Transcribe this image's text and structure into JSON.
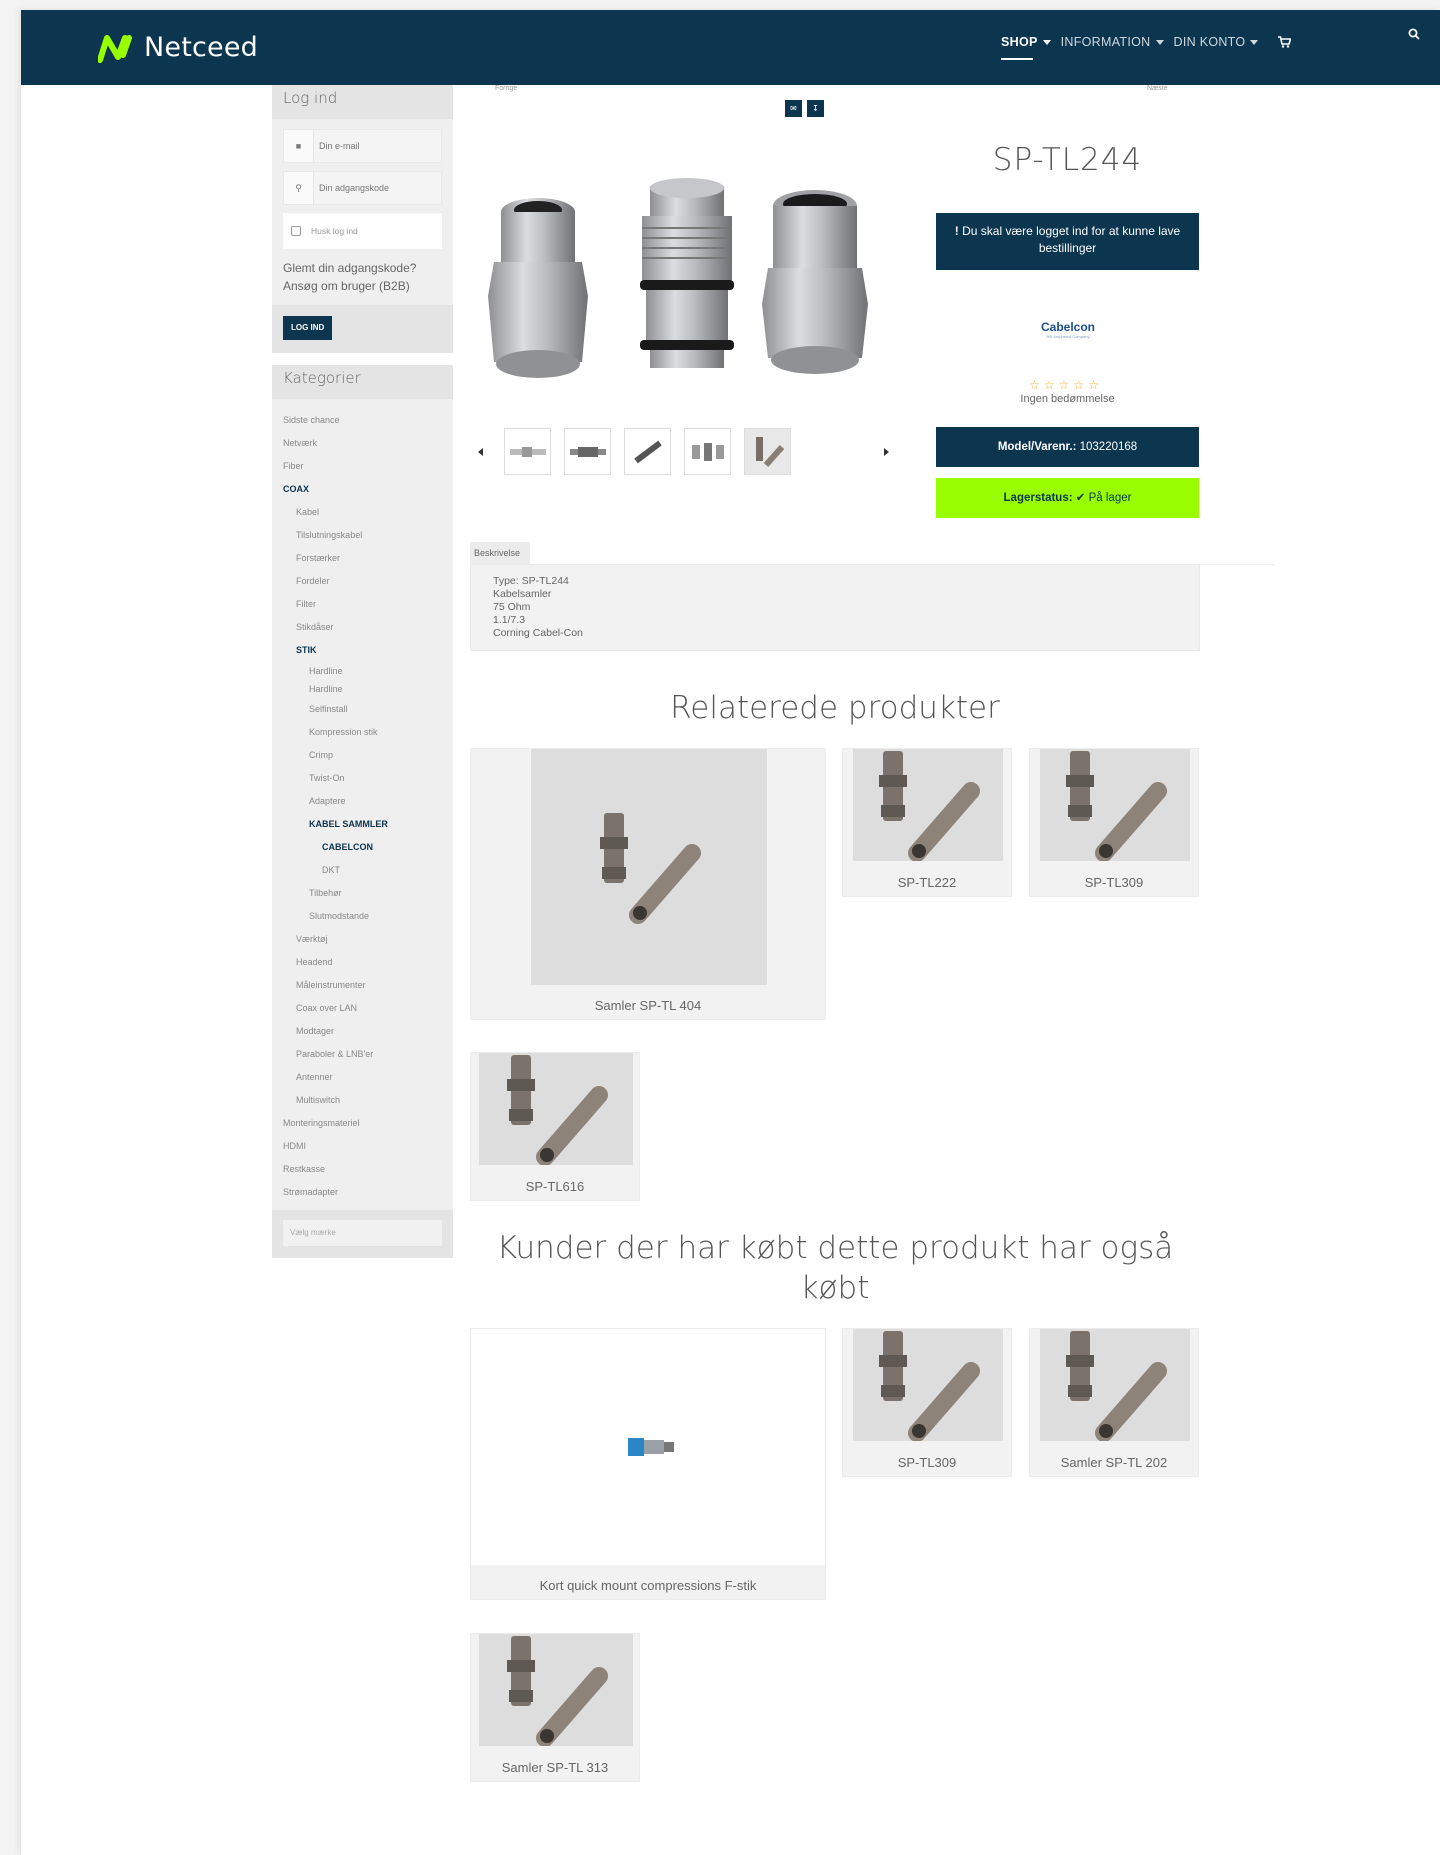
{
  "brand": {
    "name": "Netceed",
    "accent": "#99ff00",
    "navy": "#0c3550"
  },
  "nav": {
    "shop": "SHOP",
    "information": "INFORMATION",
    "account": "DIN KONTO"
  },
  "login": {
    "title": "Log ind",
    "email_placeholder": "Din e-mail",
    "password_placeholder": "Din adgangskode",
    "remember": "Husk log ind",
    "forgot": "Glemt din adgangskode?",
    "apply": "Ansøg om bruger (B2B)",
    "button": "LOG IND"
  },
  "categories": {
    "title": "Kategorier",
    "items": [
      {
        "label": "Sidste chance",
        "level": 0
      },
      {
        "label": "Netværk",
        "level": 0
      },
      {
        "label": "Fiber",
        "level": 0
      },
      {
        "label": "COAX",
        "level": 0,
        "selected": true
      },
      {
        "label": "Kabel",
        "level": 1
      },
      {
        "label": "Tilslutningskabel",
        "level": 1
      },
      {
        "label": "Forstærker",
        "level": 1
      },
      {
        "label": "Fordeler",
        "level": 1
      },
      {
        "label": "Filter",
        "level": 1
      },
      {
        "label": "Stikdåser",
        "level": 1
      },
      {
        "label": "STIK",
        "level": 1,
        "selected": true
      },
      {
        "label": "Hardline",
        "level": 2
      },
      {
        "label": "Hardline",
        "level": 2
      },
      {
        "label": "Selfinstall",
        "level": 2
      },
      {
        "label": "Kompression stik",
        "level": 2
      },
      {
        "label": "Crimp",
        "level": 2
      },
      {
        "label": "Twist-On",
        "level": 2
      },
      {
        "label": "Adaptere",
        "level": 2
      },
      {
        "label": "KABEL SAMMLER",
        "level": 2,
        "selected": true
      },
      {
        "label": "CABELCON",
        "level": 3,
        "selected": true
      },
      {
        "label": "DKT",
        "level": 3
      },
      {
        "label": "Tilbehør",
        "level": 2
      },
      {
        "label": "Slutmodstande",
        "level": 2
      },
      {
        "label": "Værktøj",
        "level": 1
      },
      {
        "label": "Headend",
        "level": 1
      },
      {
        "label": "Måleinstrumenter",
        "level": 1
      },
      {
        "label": "Coax over LAN",
        "level": 1
      },
      {
        "label": "Modtager",
        "level": 1
      },
      {
        "label": "Paraboler & LNB'er",
        "level": 1
      },
      {
        "label": "Antenner",
        "level": 1
      },
      {
        "label": "Multiswitch",
        "level": 1
      },
      {
        "label": "Monteringsmateriel",
        "level": 0
      },
      {
        "label": "HDMI",
        "level": 0
      },
      {
        "label": "Restkasse",
        "level": 0
      },
      {
        "label": "Strømadapter",
        "level": 0
      }
    ],
    "brand_placeholder": "Vælg mærke"
  },
  "product": {
    "prev": "Forrige",
    "next": "Næste",
    "title": "SP-TL244",
    "login_notice": "Du skal være logget ind for at kunne lave bestillinger",
    "manufacturer": "Cabelcon",
    "manufacturer_tagline": "RR Amphenol Company",
    "rating_text": "Ingen bedømmelse",
    "rating_value": 0,
    "model_label": "Model/Varenr.:",
    "model_value": "103220168",
    "stock_label": "Lagerstatus:",
    "stock_value": "På lager",
    "description_tab": "Beskrivelse",
    "description_lines": [
      "Type: SP-TL244",
      "Kabelsamler",
      "75 Ohm",
      "1.1/7.3",
      "Corning Cabel-Con"
    ]
  },
  "related": {
    "title": "Relaterede produkter",
    "items": [
      "Samler SP-TL 404",
      "SP-TL222",
      "SP-TL309",
      "SP-TL616"
    ]
  },
  "also_bought": {
    "title": "Kunder der har købt dette produkt har også købt",
    "items": [
      "Kort quick mount compressions F-stik",
      "SP-TL309",
      "Samler SP-TL 202",
      "Samler SP-TL 313"
    ]
  }
}
